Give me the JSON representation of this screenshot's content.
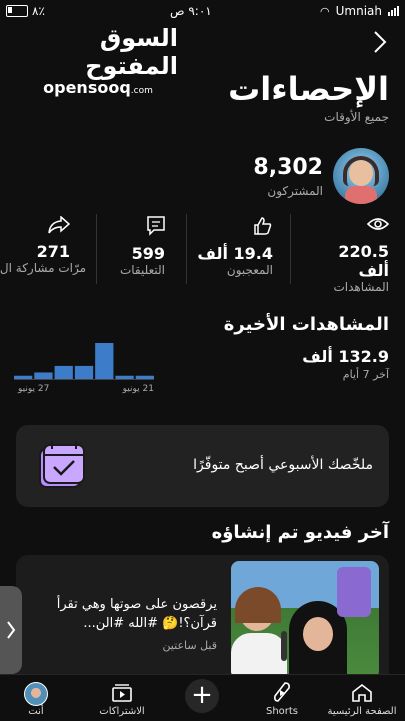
{
  "status_bar": {
    "battery": "٨٪",
    "time": "٩:٠١ ص",
    "carrier": "Umniah"
  },
  "watermark": {
    "arabic": "السوق المفتوح",
    "latin": "opensooq",
    "suffix": ".com"
  },
  "header": {
    "title": "الإحصاءات",
    "subtitle": "جميع الأوقات"
  },
  "subscribers": {
    "value": "8,302",
    "label": "المشتركون"
  },
  "stats": [
    {
      "value": "220.5 ألف",
      "label": "المشاهدات",
      "icon": "eye-icon"
    },
    {
      "value": "19.4 ألف",
      "label": "المعجبون",
      "icon": "thumb-up-icon"
    },
    {
      "value": "599",
      "label": "التعليقات",
      "icon": "comment-icon"
    },
    {
      "value": "271",
      "label": "مرّات مشاركة ال",
      "icon": "share-icon"
    }
  ],
  "recent_views": {
    "title": "المشاهدات الأخيرة",
    "value": "132.9 ألف",
    "period": "آخر 7 أيام",
    "chart_data": {
      "type": "bar",
      "values": [
        1,
        2,
        4,
        4,
        11,
        1,
        1
      ],
      "x_tick_left": "27 يونيو",
      "x_tick_right": "21 يونيو"
    }
  },
  "weekly_summary": {
    "text": "ملخّصك الأسبوعي أصبح متوفّرًا",
    "icon": "calendar-check-icon"
  },
  "latest_video": {
    "section_title": "آخر فيديو تم إنشاؤه",
    "title": "يرقصون على صوتها وهي تقرأ قرآن؟!🤔 #الله #الن...",
    "time_ago": "قبل ساعتين"
  },
  "tabs": [
    {
      "label": "الصفحة الرئيسية",
      "icon": "home-icon"
    },
    {
      "label": "Shorts",
      "icon": "shorts-icon"
    },
    {
      "label": "",
      "icon": "create-plus-icon"
    },
    {
      "label": "الاشتراكات",
      "icon": "subscriptions-icon"
    },
    {
      "label": "أنت",
      "icon": "avatar-icon"
    }
  ],
  "colors": {
    "background": "#0f0f0f",
    "bar": "#3d7cc9",
    "card": "#222222",
    "icon_purple": "#b98cff"
  }
}
